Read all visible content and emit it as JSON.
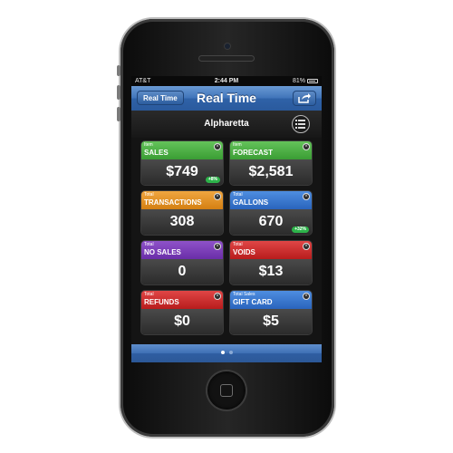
{
  "status_bar": {
    "carrier": "AT&T",
    "time": "2:44 PM",
    "battery": "81%"
  },
  "nav": {
    "back_label": "Real Time",
    "title": "Real Time",
    "share_icon": "share-icon"
  },
  "location": {
    "name": "Alpharetta",
    "menu_icon": "list-icon"
  },
  "tiles": [
    {
      "small": "Item",
      "label": "SALES",
      "value": "$749",
      "badge": "+8%",
      "color": "#4aab40"
    },
    {
      "small": "Item",
      "label": "FORECAST",
      "value": "$2,581",
      "badge": "",
      "color": "#4aab40"
    },
    {
      "small": "Total",
      "label": "TRANSACTIONS",
      "value": "308",
      "badge": "",
      "color": "#e0901f"
    },
    {
      "small": "Total",
      "label": "GALLONS",
      "value": "670",
      "badge": "+32%",
      "color": "#3474cf"
    },
    {
      "small": "Total",
      "label": "NO SALES",
      "value": "0",
      "badge": "",
      "color": "#7a3cb8"
    },
    {
      "small": "Total",
      "label": "VOIDS",
      "value": "$13",
      "badge": "",
      "color": "#cc2b2b"
    },
    {
      "small": "Total",
      "label": "REFUNDS",
      "value": "$0",
      "badge": "",
      "color": "#cc2b2b"
    },
    {
      "small": "Total Sales",
      "label": "GIFT CARD",
      "value": "$5",
      "badge": "",
      "color": "#3474cf"
    }
  ],
  "pager": {
    "page": 1,
    "pages": 2
  }
}
